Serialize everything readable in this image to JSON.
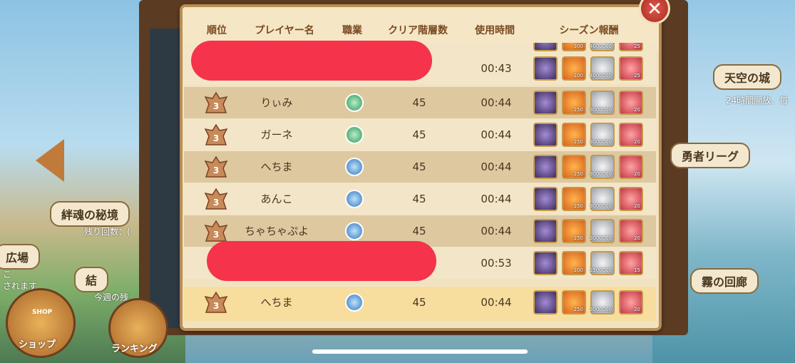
{
  "background": {
    "left_sign_1": "絆魂の秘境",
    "left_sub_1": "残り回数：(",
    "left_sign_2": "広場",
    "left_sub_2a": "こ",
    "left_sub_2b": "されます",
    "left_sign_3": "結",
    "left_sub_3": "今週の残",
    "right_sign_1": "天空の城",
    "right_sub_1": "24時間開放、毎",
    "right_sign_2": "勇者リーグ",
    "right_sign_3": "霧の回廊",
    "shop_label": "ショップ",
    "ranking_label": "ランキング",
    "shop_badge": "SHOP"
  },
  "table": {
    "headers": [
      "順位",
      "プレイヤー名",
      "職業",
      "クリア階層数",
      "使用時間",
      "シーズン報酬"
    ],
    "rows": [
      {
        "rank": "",
        "name": "",
        "job": "",
        "floors": "",
        "time": "00:43",
        "rewards": [
          "",
          "200",
          "4000000",
          "25"
        ],
        "redacted": true,
        "style": "light"
      },
      {
        "rank": "3",
        "name": "りぃみ",
        "job": "green",
        "floors": "45",
        "time": "00:44",
        "rewards": [
          "",
          "250",
          "3000000",
          "20"
        ],
        "redacted": false,
        "style": "dark"
      },
      {
        "rank": "3",
        "name": "ガーネ",
        "job": "green",
        "floors": "45",
        "time": "00:44",
        "rewards": [
          "",
          "250",
          "3000000",
          "20"
        ],
        "redacted": false,
        "style": "light"
      },
      {
        "rank": "3",
        "name": "へちま",
        "job": "blue",
        "floors": "45",
        "time": "00:44",
        "rewards": [
          "",
          "250",
          "3000000",
          "20"
        ],
        "redacted": false,
        "style": "dark"
      },
      {
        "rank": "3",
        "name": "あんこ",
        "job": "blue",
        "floors": "45",
        "time": "00:44",
        "rewards": [
          "",
          "250",
          "3000000",
          "20"
        ],
        "redacted": false,
        "style": "light"
      },
      {
        "rank": "3",
        "name": "ちゃちゃぷよ",
        "job": "blue",
        "floors": "45",
        "time": "00:44",
        "rewards": [
          "",
          "250",
          "3000000",
          "20"
        ],
        "redacted": false,
        "style": "dark"
      },
      {
        "rank": "",
        "name": "",
        "job": "",
        "floors": "",
        "time": "00:53",
        "rewards": [
          "",
          "200",
          "2500000",
          "15"
        ],
        "redacted": true,
        "style": "light"
      },
      {
        "rank": "3",
        "name": "へちま",
        "job": "blue",
        "floors": "45",
        "time": "00:44",
        "rewards": [
          "",
          "250",
          "3000000",
          "20"
        ],
        "redacted": false,
        "style": "mine"
      }
    ],
    "top_partial_rewards": [
      "",
      "300",
      "4000000",
      "25"
    ]
  },
  "close_icon": "close-icon",
  "colors": {
    "accent": "#b98d55",
    "close": "#d9443a"
  }
}
